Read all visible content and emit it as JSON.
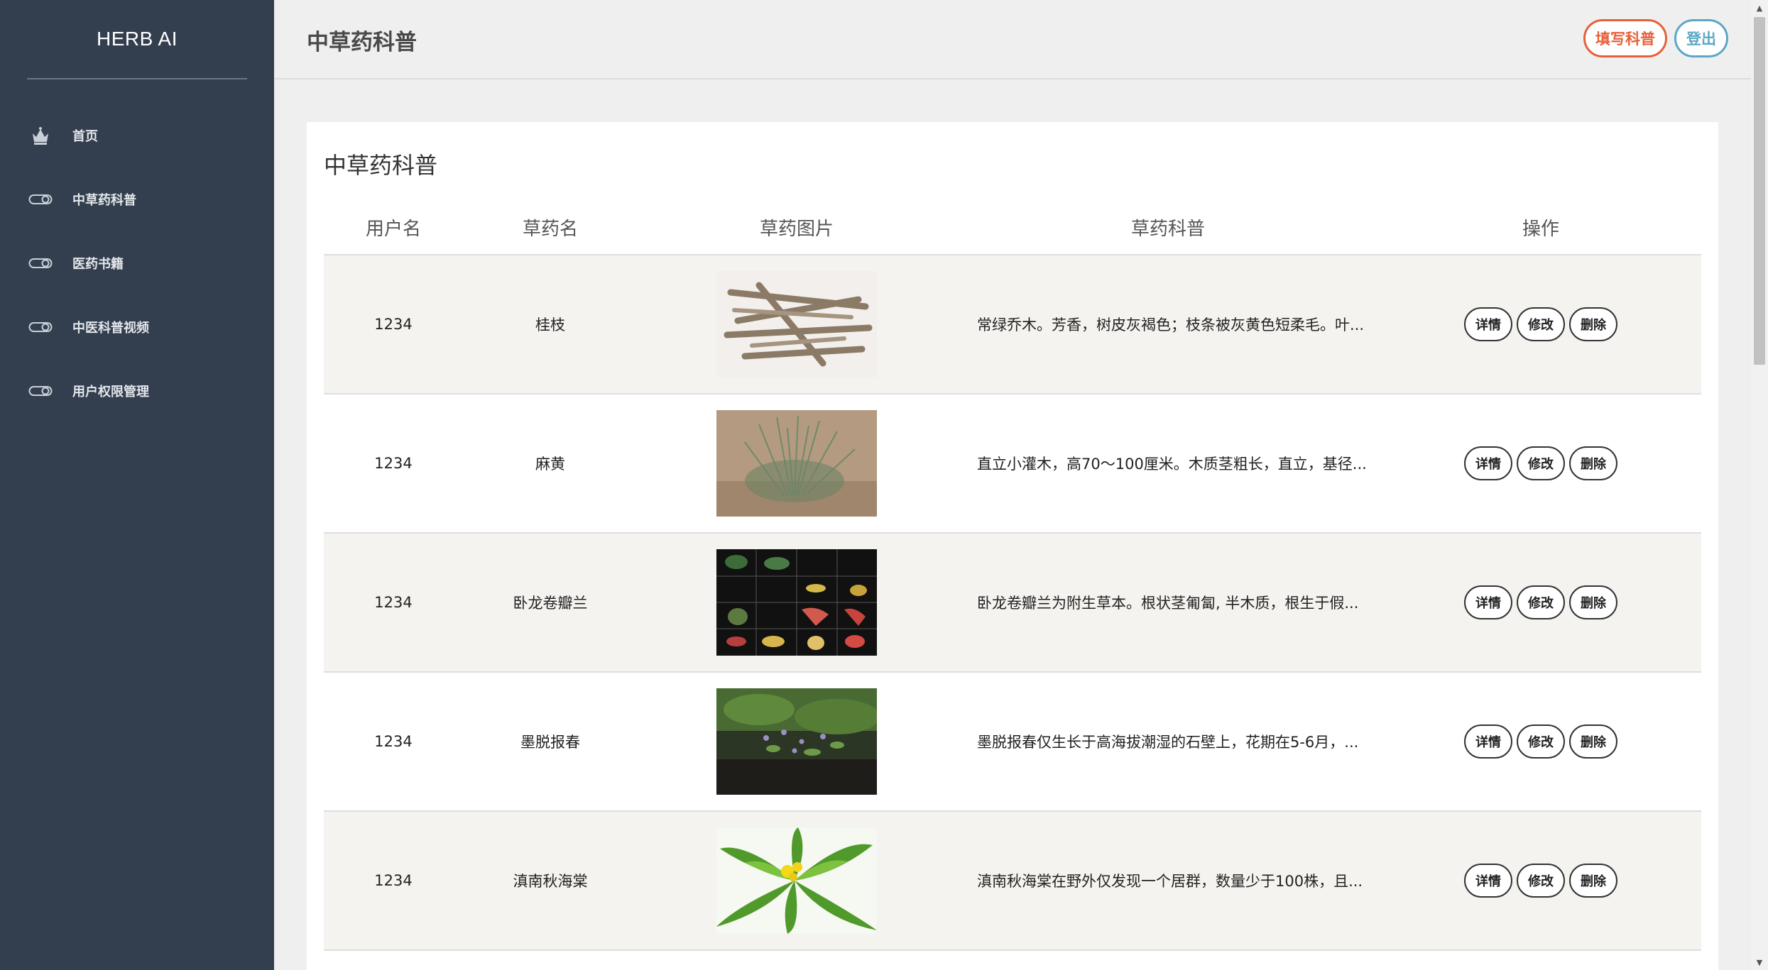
{
  "brand": "HERB AI",
  "sidebar": {
    "items": [
      {
        "label": "首页",
        "icon": "crown-icon"
      },
      {
        "label": "中草药科普",
        "icon": "toggle-icon"
      },
      {
        "label": "医药书籍",
        "icon": "toggle-icon"
      },
      {
        "label": "中医科普视频",
        "icon": "toggle-icon"
      },
      {
        "label": "用户权限管理",
        "icon": "toggle-icon"
      }
    ]
  },
  "header": {
    "title": "中草药科普",
    "write_label": "填写科普",
    "logout_label": "登出"
  },
  "card": {
    "title": "中草药科普"
  },
  "table": {
    "columns": [
      "用户名",
      "草药名",
      "草药图片",
      "草药科普",
      "操作"
    ],
    "buttons": {
      "detail": "详情",
      "edit": "修改",
      "delete": "删除"
    },
    "rows": [
      {
        "user": "1234",
        "name": "桂枝",
        "desc": "常绿乔木。芳香，树皮灰褐色；枝条被灰黄色短柔毛。叶..."
      },
      {
        "user": "1234",
        "name": "麻黄",
        "desc": "直立小灌木，高70～100厘米。木质茎粗长，直立，基径..."
      },
      {
        "user": "1234",
        "name": "卧龙卷瓣兰",
        "desc": "卧龙卷瓣兰为附生草本。根状茎匍匐, 半木质，根生于假..."
      },
      {
        "user": "1234",
        "name": "墨脱报春",
        "desc": "墨脱报春仅生长于高海拔潮湿的石壁上，花期在5-6月，..."
      },
      {
        "user": "1234",
        "name": "滇南秋海棠",
        "desc": "滇南秋海棠在野外仅发现一个居群，数量少于100株，且..."
      }
    ]
  }
}
